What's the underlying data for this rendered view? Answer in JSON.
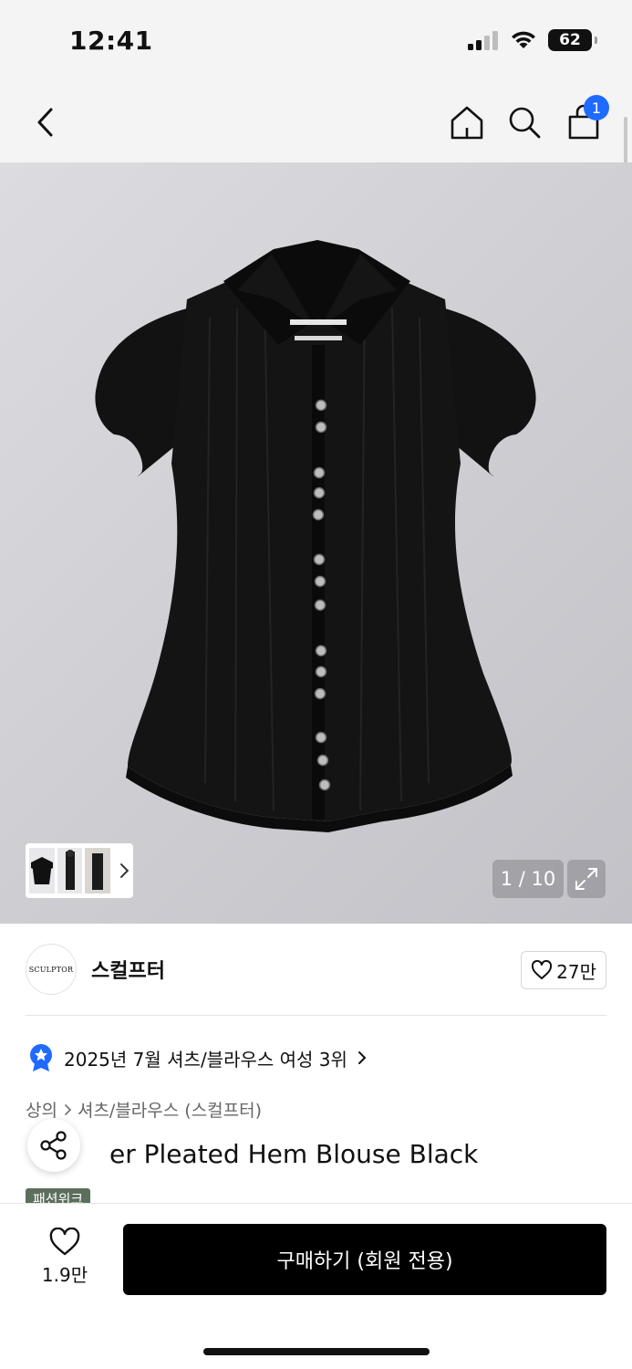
{
  "status_bar": {
    "time": "12:41",
    "battery": "62"
  },
  "nav": {
    "back_icon": "chevron-left-icon",
    "home_icon": "home-icon",
    "search_icon": "search-icon",
    "cart_icon": "shopping-bag-icon",
    "cart_badge": "1"
  },
  "gallery": {
    "page_counter": "1 / 10",
    "expand_icon": "expand-icon"
  },
  "brand": {
    "logo_text": "SCULPTOR",
    "name": "스컬프터",
    "like_count": "27만"
  },
  "ranking": {
    "text": "2025년 7월 셔츠/블라우스 여성 3위",
    "badge_icon": "star-badge-icon"
  },
  "breadcrumb": {
    "level1": "상의",
    "level2": "셔츠/블라우스 (스컬프터)"
  },
  "product": {
    "title_visible": "er Pleated Hem Blouse Black",
    "tag": "패션위크"
  },
  "bottom": {
    "wish_count": "1.9만",
    "buy_label": "구매하기 (회원 전용)"
  },
  "colors": {
    "accent_blue": "#1f6bff",
    "tag_green": "#5c6f5c",
    "buy_black": "#000000"
  }
}
